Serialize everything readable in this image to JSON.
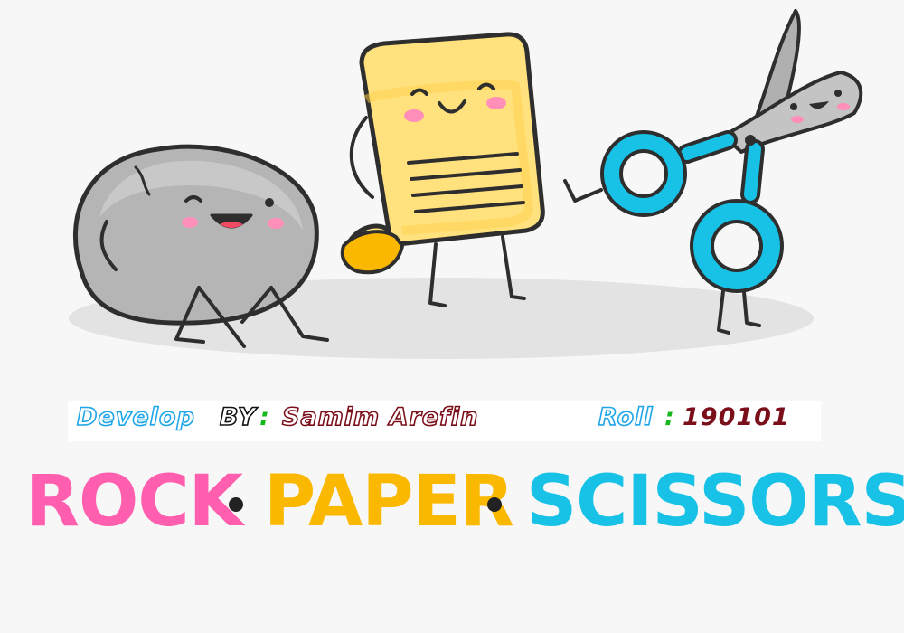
{
  "credits": {
    "develop_label": "Develop",
    "by_label": "BY",
    "by_colon": ":",
    "developer_name": "Samim Arefin",
    "roll_label": "Roll",
    "roll_colon": ":",
    "roll_number": "190101"
  },
  "title": {
    "rock": "ROCK",
    "paper": "PAPER",
    "scissors": "SCISSORS"
  },
  "colors": {
    "rock": "#ff5fae",
    "paper": "#fbb800",
    "scissors": "#18c2e6",
    "background": "#f7f7f7"
  },
  "illustrations": [
    "rock-character",
    "paper-character",
    "scissors-character"
  ]
}
